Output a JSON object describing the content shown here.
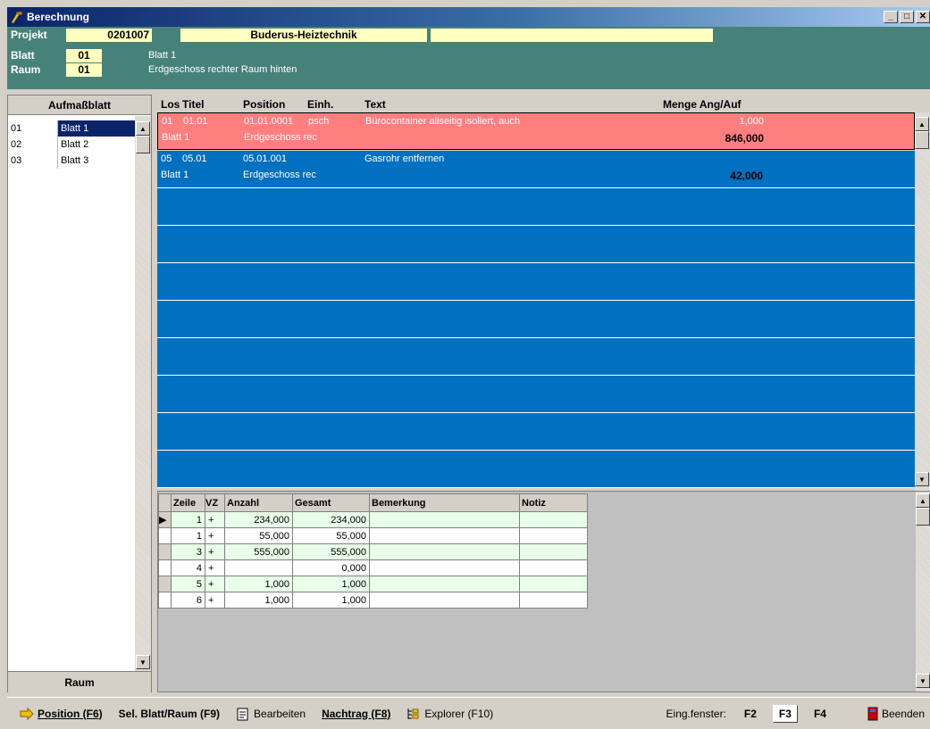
{
  "window": {
    "title": "Berechnung"
  },
  "header": {
    "projekt_label": "Projekt",
    "projekt_nr": "0201007",
    "projekt_name": "Buderus-Heiztechnik",
    "blatt_label": "Blatt",
    "blatt_nr": "01",
    "blatt_text": "Blatt 1",
    "raum_label": "Raum",
    "raum_nr": "01",
    "raum_text": "Erdgeschoss rechter Raum hinten"
  },
  "left": {
    "header": "Aufmaßblatt",
    "items": [
      {
        "nr": "01",
        "name": "Blatt 1"
      },
      {
        "nr": "02",
        "name": "Blatt 2"
      },
      {
        "nr": "03",
        "name": "Blatt 3"
      }
    ],
    "footer": "Raum"
  },
  "positions": {
    "headers": {
      "los": "Los",
      "titel": "Titel",
      "position": "Position",
      "einh": "Einh.",
      "text": "Text",
      "menge": "Menge Ang/Auf"
    },
    "rows": [
      {
        "los": "01",
        "titel": "01.01",
        "position": "01.01.0001",
        "einh": "psch",
        "text": "Bürocontainer allseitig isoliert, auch",
        "menge": "1,000",
        "blatt": "Blatt 1",
        "raum": "Erdgeschoss rec",
        "summe": "846,000"
      },
      {
        "los": "05",
        "titel": "05.01",
        "position": "05.01.001",
        "einh": "",
        "text": "Gasrohr entfernen",
        "menge": "",
        "blatt": "Blatt 1",
        "raum": "Erdgeschoss rec",
        "summe": "42,000"
      }
    ]
  },
  "grid": {
    "headers": {
      "zeile": "Zeile",
      "vz": "VZ",
      "anzahl": "Anzahl",
      "gesamt": "Gesamt",
      "bemerkung": "Bemerkung",
      "notiz": "Notiz"
    },
    "rows": [
      {
        "zeile": "1",
        "vz": "+",
        "anzahl": "234,000",
        "gesamt": "234,000"
      },
      {
        "zeile": "1",
        "vz": "+",
        "anzahl": "55,000",
        "gesamt": "55,000"
      },
      {
        "zeile": "3",
        "vz": "+",
        "anzahl": "555,000",
        "gesamt": "555,000"
      },
      {
        "zeile": "4",
        "vz": "+",
        "anzahl": "",
        "gesamt": "0,000"
      },
      {
        "zeile": "5",
        "vz": "+",
        "anzahl": "1,000",
        "gesamt": "1,000"
      },
      {
        "zeile": "6",
        "vz": "+",
        "anzahl": "1,000",
        "gesamt": "1,000"
      }
    ]
  },
  "toolbar": {
    "position": "Position (F6)",
    "sel": "Sel. Blatt/Raum (F9)",
    "bearbeiten": "Bearbeiten",
    "nachtrag": "Nachtrag (F8)",
    "explorer": "Explorer (F10)",
    "eing_label": "Eing.fenster:",
    "f2": "F2",
    "f3": "F3",
    "f4": "F4",
    "beenden": "Beenden"
  }
}
